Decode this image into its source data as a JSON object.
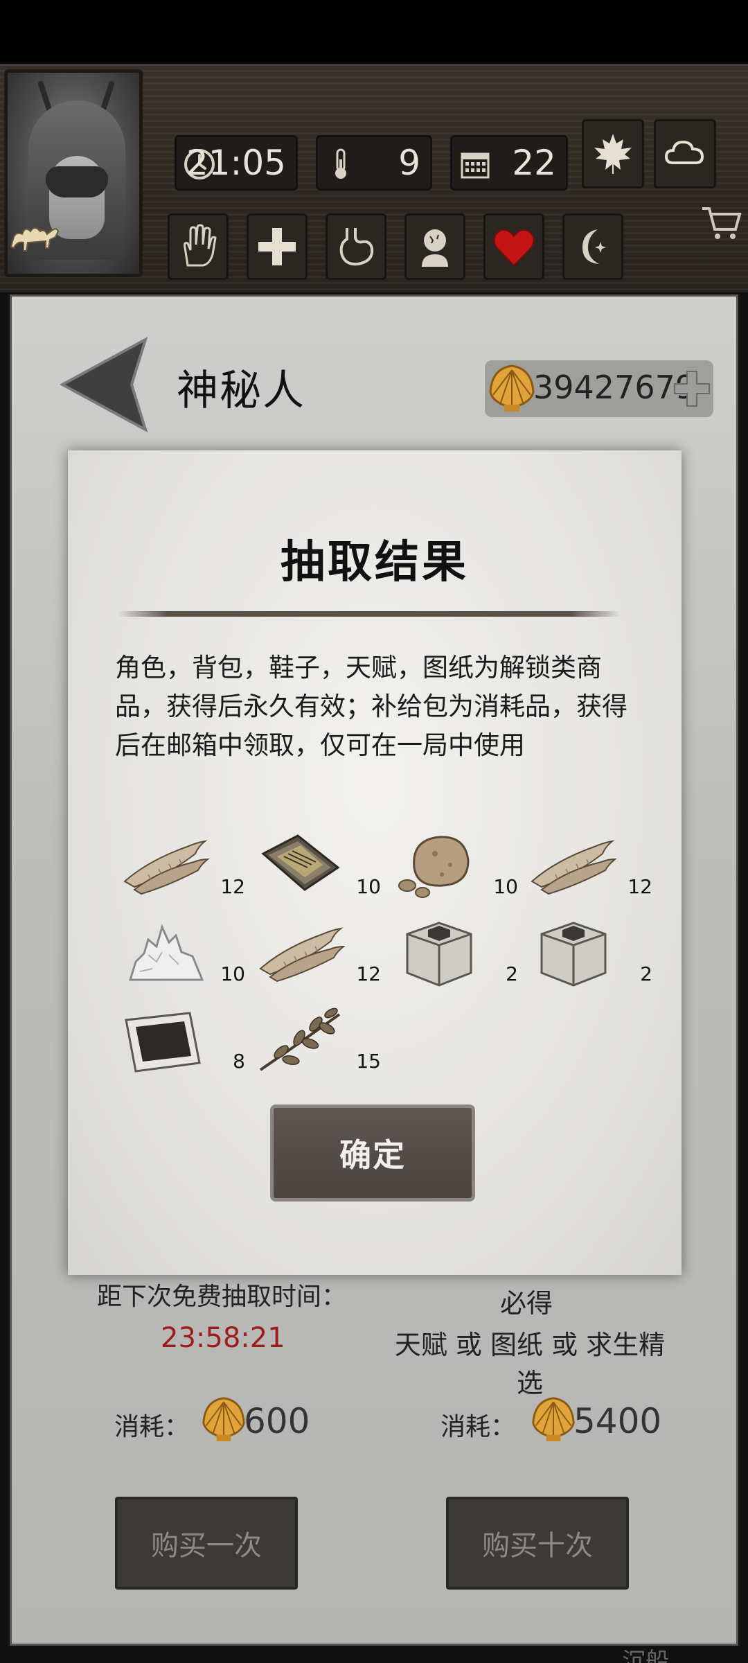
{
  "hud": {
    "clock": "21:05",
    "temperature": "9",
    "day": "22"
  },
  "header": {
    "title": "神秘人",
    "shell_balance": "39427679"
  },
  "modal": {
    "title": "抽取结果",
    "description": "角色，背包，鞋子，天赋，图纸为解锁类商品，获得后永久有效；补给包为消耗品，获得后在邮箱中领取，仅可在一局中使用",
    "rewards": [
      {
        "icon": "dried-fish-icon",
        "count": "12"
      },
      {
        "icon": "stone-tablet-icon",
        "count": "10"
      },
      {
        "icon": "rock-ore-icon",
        "count": "10"
      },
      {
        "icon": "dried-fish-icon",
        "count": "12"
      },
      {
        "icon": "salt-crystal-icon",
        "count": "10"
      },
      {
        "icon": "dried-fish-icon",
        "count": "12"
      },
      {
        "icon": "supply-crate-icon",
        "count": "2"
      },
      {
        "icon": "supply-crate-icon",
        "count": "2"
      },
      {
        "icon": "charcoal-cloth-icon",
        "count": "8"
      },
      {
        "icon": "herb-branch-icon",
        "count": "15"
      }
    ],
    "confirm_label": "确定"
  },
  "shop": {
    "free_draw_label": "距下次免费抽取时间：",
    "free_draw_timer": "23:58:21",
    "guarantee_label": "必得",
    "guarantee_desc": "天赋 或 图纸 或 求生精选",
    "cost_label": "消耗：",
    "single_cost": "600",
    "ten_cost": "5400",
    "buy_one_label": "购买一次",
    "buy_ten_label": "购买十次",
    "footer_partial": "沉船"
  },
  "colors": {
    "timer_red": "#9a1d1a",
    "shell_gold": "#e0a43a",
    "heart_red": "#c41515"
  }
}
